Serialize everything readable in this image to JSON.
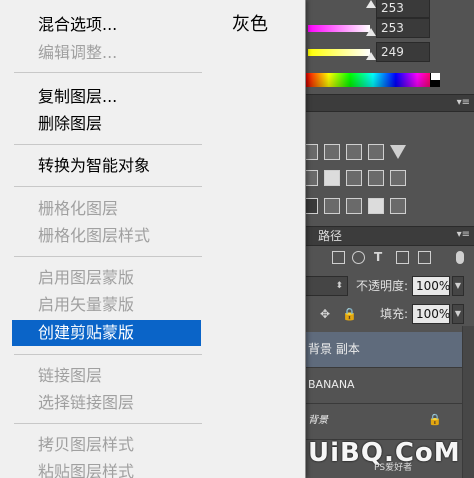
{
  "colors": {
    "menu_bg": "#f0f0f0",
    "highlight": "#0a64c8",
    "disabled_text": "#a0a0a0",
    "panel_bg": "#535353",
    "selected_layer": "#5f6b7c"
  },
  "context_menu": {
    "items": [
      {
        "label": "混合选项...",
        "enabled": true
      },
      {
        "label": "编辑调整...",
        "enabled": false
      },
      {
        "label": "复制图层...",
        "enabled": true
      },
      {
        "label": "删除图层",
        "enabled": true
      },
      {
        "label": "转换为智能对象",
        "enabled": true
      },
      {
        "label": "栅格化图层",
        "enabled": false
      },
      {
        "label": "栅格化图层样式",
        "enabled": false
      },
      {
        "label": "启用图层蒙版",
        "enabled": false
      },
      {
        "label": "启用矢量蒙版",
        "enabled": false
      },
      {
        "label": "创建剪贴蒙版",
        "enabled": true,
        "highlighted": true
      },
      {
        "label": "链接图层",
        "enabled": false
      },
      {
        "label": "选择链接图层",
        "enabled": false
      },
      {
        "label": "拷贝图层样式",
        "enabled": false
      },
      {
        "label": "粘贴图层样式",
        "enabled": false
      }
    ],
    "right_label": "灰色"
  },
  "color_panel": {
    "values": [
      "253",
      "253",
      "249"
    ]
  },
  "paths_tab": {
    "label": "路径"
  },
  "layers_panel": {
    "opacity_label": "不透明度:",
    "opacity_value": "100%",
    "fill_label": "填充:",
    "fill_value": "100%",
    "layers": [
      {
        "name": "背景 副本",
        "selected": true
      },
      {
        "name": "BANANA",
        "selected": false
      },
      {
        "name": "背景",
        "selected": false,
        "locked": true
      }
    ]
  },
  "watermark": {
    "text": "UiBQ.CoM",
    "sub": "PS爱好者"
  }
}
